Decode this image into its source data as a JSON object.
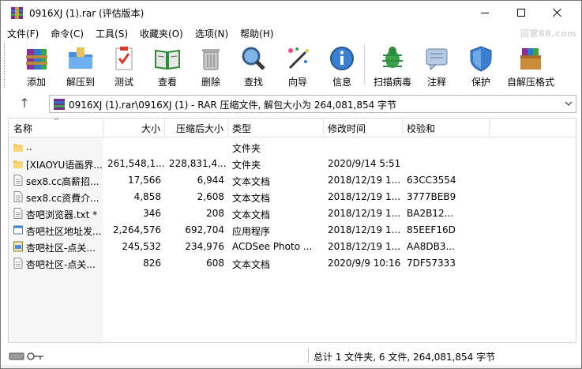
{
  "window": {
    "title": "0916XJ (1).rar (评估版本)"
  },
  "menu": {
    "items": [
      "文件(F)",
      "命令(C)",
      "工具(S)",
      "收藏夹(O)",
      "选项(N)",
      "帮助(H)"
    ],
    "watermark": "回家88.com"
  },
  "toolbar": {
    "buttons": [
      {
        "label": "添加",
        "icon": "add-archive-icon"
      },
      {
        "label": "解压到",
        "icon": "extract-to-icon"
      },
      {
        "label": "测试",
        "icon": "test-icon"
      },
      {
        "label": "查看",
        "icon": "view-icon"
      },
      {
        "label": "删除",
        "icon": "delete-icon"
      },
      {
        "label": "查找",
        "icon": "find-icon"
      },
      {
        "label": "向导",
        "icon": "wizard-icon"
      },
      {
        "label": "信息",
        "icon": "info-icon"
      },
      {
        "label": "扫描病毒",
        "icon": "virus-scan-icon"
      },
      {
        "label": "注释",
        "icon": "comment-icon"
      },
      {
        "label": "保护",
        "icon": "protect-icon"
      },
      {
        "label": "自解压格式",
        "icon": "sfx-icon"
      }
    ]
  },
  "address": {
    "path": "0916XJ (1).rar\\0916XJ (1) - RAR 压缩文件, 解包大小为 264,081,854 字节"
  },
  "columns": {
    "name": "名称",
    "size": "大小",
    "packed": "压缩后大小",
    "type": "类型",
    "modified": "修改时间",
    "crc": "校验和"
  },
  "files": [
    {
      "name": "..",
      "size": "",
      "packed": "",
      "type": "文件夹",
      "modified": "",
      "crc": "",
      "icon": "folder-icon"
    },
    {
      "name": "[XIAOYU语画界...",
      "size": "261,548,1...",
      "packed": "228,831,4...",
      "type": "文件夹",
      "modified": "2020/9/14 5:51",
      "crc": "",
      "icon": "folder-icon"
    },
    {
      "name": "sex8.cc高薪招...",
      "size": "17,566",
      "packed": "6,944",
      "type": "文本文档",
      "modified": "2018/12/19 1...",
      "crc": "63CC3554",
      "icon": "text-file-icon"
    },
    {
      "name": "sex8.cc资費介...",
      "size": "4,858",
      "packed": "2,608",
      "type": "文本文档",
      "modified": "2018/12/19 1...",
      "crc": "3777BEB9",
      "icon": "text-file-icon"
    },
    {
      "name": "杏吧浏览器.txt *",
      "size": "346",
      "packed": "208",
      "type": "文本文档",
      "modified": "2018/12/19 1...",
      "crc": "BA2B12...",
      "icon": "text-file-icon"
    },
    {
      "name": "杏吧社区地址发...",
      "size": "2,264,576",
      "packed": "692,704",
      "type": "应用程序",
      "modified": "2018/12/19 1...",
      "crc": "85EEF16D",
      "icon": "exe-file-icon"
    },
    {
      "name": "杏吧社区-点关...",
      "size": "245,532",
      "packed": "234,976",
      "type": "ACDSee Photo ...",
      "modified": "2018/12/19 1...",
      "crc": "AA8DB3...",
      "icon": "jpg-file-icon"
    },
    {
      "name": "杏吧社区-点关...",
      "size": "826",
      "packed": "608",
      "type": "文本文档",
      "modified": "2020/9/9 10:16",
      "crc": "7DF57333",
      "icon": "text-file-icon"
    }
  ],
  "status": {
    "summary": "总计 1 文件夹, 6 文件, 264,081,854 字节"
  }
}
